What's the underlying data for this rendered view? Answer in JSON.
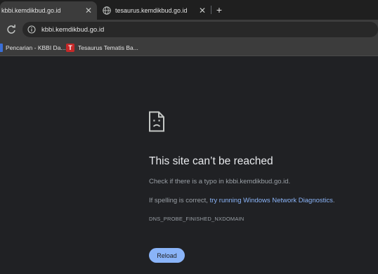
{
  "tabs": [
    {
      "title": "kbbi.kemdikbud.go.id",
      "close": "✕"
    },
    {
      "title": "tesaurus.kemdikbud.go.id",
      "close": "✕",
      "icon": "globe-icon"
    }
  ],
  "new_tab": "+",
  "omnibox": {
    "url": "kbbi.kemdikbud.go.id",
    "icon": "info-icon"
  },
  "bookmarks": [
    {
      "label": "Pencarian - KBBI Da...",
      "icon": "kbbi-favicon"
    },
    {
      "label": "Tesaurus Tematis Ba...",
      "icon": "tesaurus-favicon",
      "icon_letter": "T"
    }
  ],
  "error": {
    "title": "This site can’t be reached",
    "subtitle": "Check if there is a typo in kbbi.kemdikbud.go.id.",
    "spelling_prefix": "If spelling is correct, ",
    "diagnostics_link": "try running Windows Network Diagnostics",
    "spelling_suffix": ".",
    "code": "DNS_PROBE_FINISHED_NXDOMAIN",
    "reload_label": "Reload"
  },
  "colors": {
    "accent": "#8ab4f8",
    "background": "#202124",
    "toolbar": "#3c3c3c"
  }
}
